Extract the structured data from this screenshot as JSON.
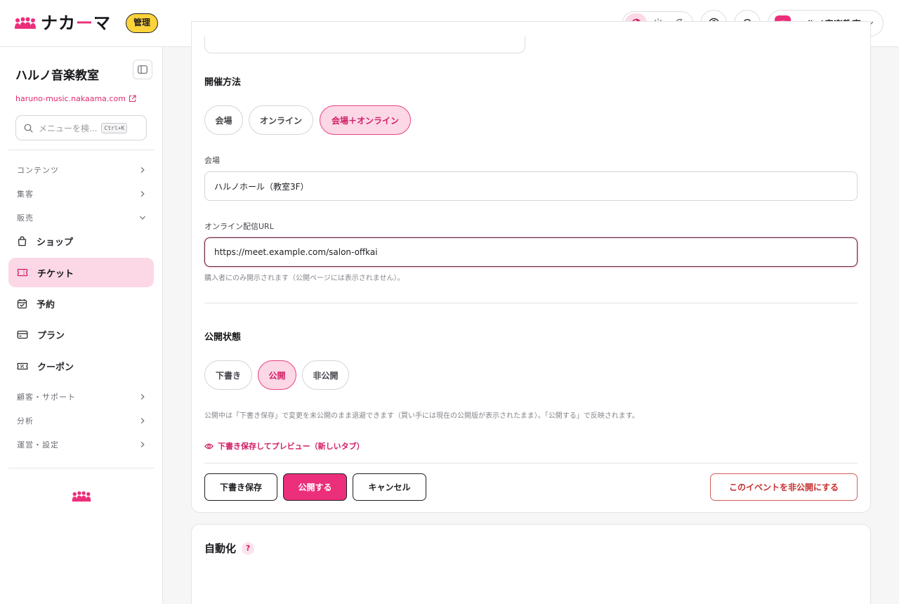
{
  "header": {
    "logo_prefix": "ナカ",
    "logo_dash": "ー",
    "logo_suffix": "マ",
    "admin_badge": "管理",
    "account_avatar": "ハ",
    "account_name": "ハルノ音楽教室"
  },
  "sidebar": {
    "site_name": "ハルノ音楽教室",
    "site_url": "haruno-music.nakaama.com",
    "search_placeholder": "メニューを検...",
    "search_shortcut": "Ctrl+K",
    "groups": {
      "contents": "コンテンツ",
      "marketing": "集客",
      "sales": "販売",
      "customers": "顧客・サポート",
      "analytics": "分析",
      "operations": "運営・設定"
    },
    "items": {
      "shop": "ショップ",
      "ticket": "チケット",
      "reservation": "予約",
      "plan": "プラン",
      "coupon": "クーポン"
    }
  },
  "form": {
    "method_title": "開催方法",
    "method_options": [
      "会場",
      "オンライン",
      "会場＋オンライン"
    ],
    "method_selected": "会場＋オンライン",
    "venue_label": "会場",
    "venue_value": "ハルノホール（教室3F）",
    "url_label": "オンライン配信URL",
    "url_value": "https://meet.example.com/salon-offkai",
    "url_help": "購入者にのみ開示されます（公開ページには表示されません）。",
    "status_title": "公開状態",
    "status_options": [
      "下書き",
      "公開",
      "非公開"
    ],
    "status_selected": "公開",
    "status_help": "公開中は「下書き保存」で変更を未公開のまま退避できます（買い手には現在の公開版が表示されたまま）。「公開する」で反映されます。",
    "preview_link": "下書き保存してプレビュー（新しいタブ）",
    "buttons": {
      "save_draft": "下書き保存",
      "publish": "公開する",
      "cancel": "キャンセル",
      "unpublish": "このイベントを非公開にする"
    }
  },
  "automation": {
    "title": "自動化",
    "help_icon": "?"
  },
  "colors": {
    "accent": "#ec2f7a",
    "accent_soft": "#fcd8e6",
    "badge": "#fdd33b",
    "danger": "#c53030"
  }
}
